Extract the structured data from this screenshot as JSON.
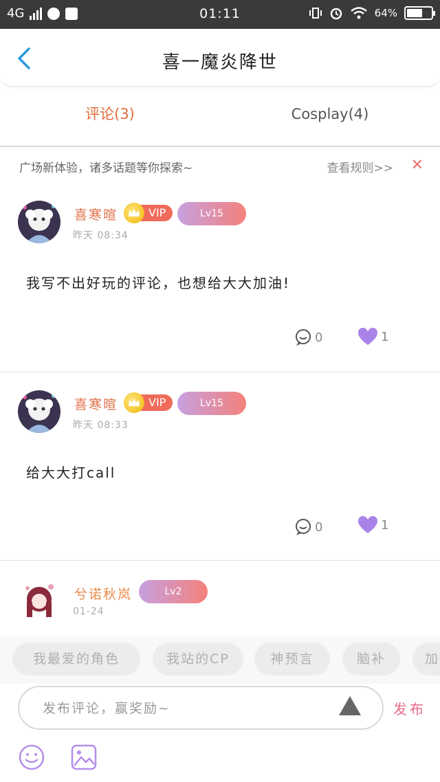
{
  "status_bar": {
    "network": "4G",
    "time": "01:11",
    "battery": "64%",
    "battery_level": 0.64
  },
  "header": {
    "title": "喜一魔炎降世"
  },
  "tabs": [
    {
      "label": "评论(3)",
      "active": true
    },
    {
      "label": "Cosplay(4)",
      "active": false
    }
  ],
  "notice": {
    "text": "广场新体验，诸多话题等你探索~",
    "rules_link": "查看规则>>",
    "close": "✕"
  },
  "comments": [
    {
      "username": "喜寒暄",
      "vip": "VIP",
      "level": "Lv15",
      "time": "昨天 08:34",
      "content": "我写不出好玩的评论，也想给大大加油!",
      "replies": "0",
      "likes": "1"
    },
    {
      "username": "喜寒暄",
      "vip": "VIP",
      "level": "Lv15",
      "time": "昨天 08:33",
      "content": "给大大打call",
      "replies": "0",
      "likes": "1"
    },
    {
      "username": "兮诺秋岚",
      "level": "Lv2",
      "time": "01-24"
    }
  ],
  "tags": [
    "我最爱的角色",
    "我站的CP",
    "神预言",
    "脑补",
    "加"
  ],
  "composer": {
    "placeholder": "发布评论，赢奖励~",
    "publish_label": "发布"
  },
  "colors": {
    "accent_orange": "#e36b3a",
    "username": "#e0704a",
    "vip_red": "#f06a5a",
    "like_purple": "#a983e8",
    "publish_pink": "#e86a8a"
  }
}
